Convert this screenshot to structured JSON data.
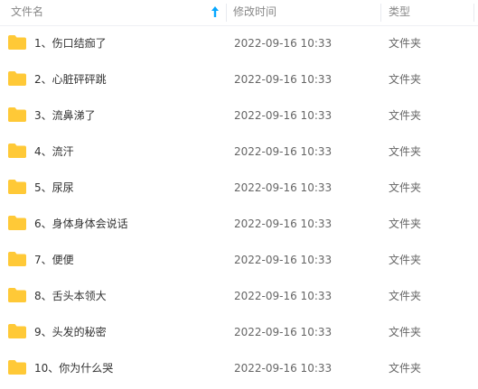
{
  "header": {
    "name_label": "文件名",
    "date_label": "修改时间",
    "type_label": "类型",
    "sort_icon": "sort-ascending-arrow",
    "sort_color": "#06a7ff"
  },
  "folder_color": "#ffc937",
  "rows": [
    {
      "name": "1、伤口结痂了",
      "modified": "2022-09-16 10:33",
      "type": "文件夹"
    },
    {
      "name": "2、心脏砰砰跳",
      "modified": "2022-09-16 10:33",
      "type": "文件夹"
    },
    {
      "name": "3、流鼻涕了",
      "modified": "2022-09-16 10:33",
      "type": "文件夹"
    },
    {
      "name": "4、流汗",
      "modified": "2022-09-16 10:33",
      "type": "文件夹"
    },
    {
      "name": "5、尿尿",
      "modified": "2022-09-16 10:33",
      "type": "文件夹"
    },
    {
      "name": "6、身体身体会说话",
      "modified": "2022-09-16 10:33",
      "type": "文件夹"
    },
    {
      "name": "7、便便",
      "modified": "2022-09-16 10:33",
      "type": "文件夹"
    },
    {
      "name": "8、舌头本领大",
      "modified": "2022-09-16 10:33",
      "type": "文件夹"
    },
    {
      "name": "9、头发的秘密",
      "modified": "2022-09-16 10:33",
      "type": "文件夹"
    },
    {
      "name": "10、你为什么哭",
      "modified": "2022-09-16 10:33",
      "type": "文件夹"
    }
  ]
}
